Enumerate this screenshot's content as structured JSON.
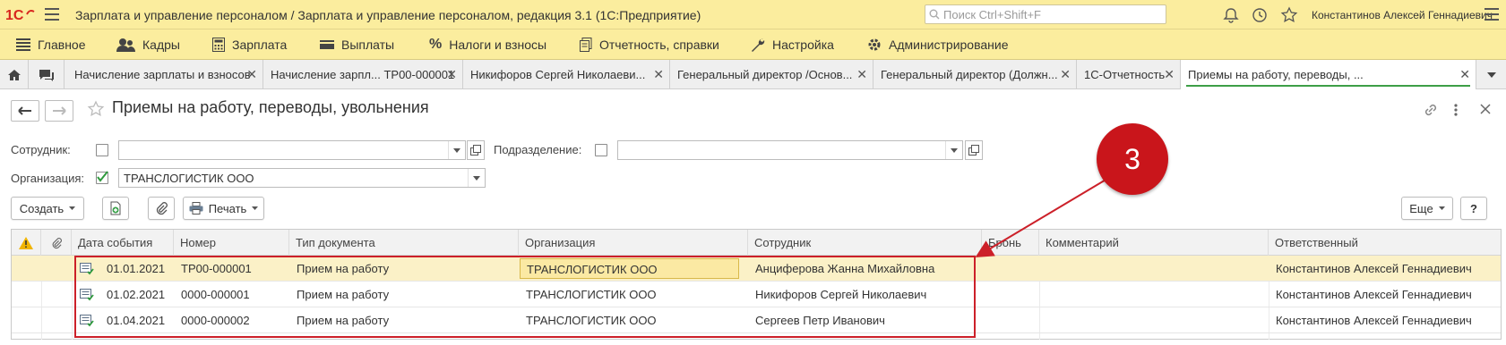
{
  "titlebar": {
    "title": "Зарплата и управление персоналом / Зарплата и управление персоналом, редакция 3.1  (1С:Предприятие)",
    "search_placeholder": "Поиск Ctrl+Shift+F",
    "user": "Константинов Алексей Геннадиевич"
  },
  "sections": [
    {
      "label": "Главное",
      "icon": "menu-icon"
    },
    {
      "label": "Кадры",
      "icon": "people-icon"
    },
    {
      "label": "Зарплата",
      "icon": "calculator-icon"
    },
    {
      "label": "Выплаты",
      "icon": "wallet-icon"
    },
    {
      "label": "Налоги и взносы",
      "icon": "percent-icon"
    },
    {
      "label": "Отчетность, справки",
      "icon": "reports-icon"
    },
    {
      "label": "Настройка",
      "icon": "wrench-icon"
    },
    {
      "label": "Администрирование",
      "icon": "gear-icon"
    }
  ],
  "tabs": [
    {
      "label": "Начисление зарплаты и взносов"
    },
    {
      "label": "Начисление зарпл... ТР00-000001"
    },
    {
      "label": "Никифоров Сергей Николаеви..."
    },
    {
      "label": "Генеральный директор /Основ..."
    },
    {
      "label": "Генеральный директор (Должн..."
    },
    {
      "label": "1С-Отчетность"
    },
    {
      "label": "Приемы на работу, переводы, ..."
    }
  ],
  "form": {
    "title": "Приемы на работу, переводы, увольнения"
  },
  "filters": {
    "employee_label": "Сотрудник:",
    "employee_value": "",
    "department_label": "Подразделение:",
    "department_value": "",
    "org_label": "Организация:",
    "org_value": "ТРАНСЛОГИСТИК ООО",
    "org_checked": true
  },
  "commands": {
    "create": "Создать",
    "print": "Печать",
    "more": "Еще",
    "help": "?"
  },
  "table": {
    "columns": [
      "Дата события",
      "Номер",
      "Тип документа",
      "Организация",
      "Сотрудник",
      "Бронь",
      "Комментарий",
      "Ответственный"
    ],
    "rows": [
      {
        "date": "01.01.2021",
        "number": "ТР00-000001",
        "type": "Прием на работу",
        "org": "ТРАНСЛОГИСТИК ООО",
        "employee": "Анциферова Жанна Михайловна",
        "bron": "",
        "comment": "",
        "responsible": "Константинов Алексей Геннадиевич"
      },
      {
        "date": "01.02.2021",
        "number": "0000-000001",
        "type": "Прием на работу",
        "org": "ТРАНСЛОГИСТИК ООО",
        "employee": "Никифоров Сергей Николаевич",
        "bron": "",
        "comment": "",
        "responsible": "Константинов Алексей Геннадиевич"
      },
      {
        "date": "01.04.2021",
        "number": "0000-000002",
        "type": "Прием на работу",
        "org": "ТРАНСЛОГИСТИК ООО",
        "employee": "Сергеев Петр Иванович",
        "bron": "",
        "comment": "",
        "responsible": "Константинов Алексей Геннадиевич"
      }
    ]
  },
  "annotation": {
    "number": "3",
    "color": "#c9151b"
  },
  "colors": {
    "header_bg": "#fbed9e",
    "selected_row": "#fbf1c7",
    "active_tab_underline": "#3d9e47"
  }
}
